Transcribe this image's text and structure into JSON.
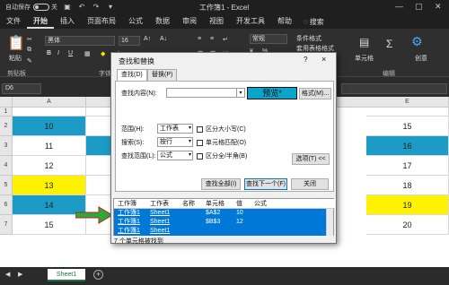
{
  "titlebar": {
    "autosave_label": "自动保存",
    "toggle_state": "关",
    "doc_title": "工作簿1 - Excel"
  },
  "menu": {
    "tabs": [
      "文件",
      "开始",
      "插入",
      "页面布局",
      "公式",
      "数据",
      "审阅",
      "视图",
      "开发工具",
      "帮助"
    ],
    "active_tab": "开始",
    "search_label": "搜索"
  },
  "ribbon": {
    "font_name": "黑体",
    "font_size": "16",
    "number_format": "常规",
    "cond_format": "条件格式",
    "table_format": "套用表格格式",
    "clipboard_label": "剪贴板",
    "font_label": "字体",
    "edit_label": "编辑",
    "create_label": "创意",
    "paste_label": "粘贴",
    "cells_label": "单元格"
  },
  "formula_bar": {
    "name_box": "D6"
  },
  "grid": {
    "columns": [
      "A",
      "",
      "",
      "",
      "",
      "",
      "",
      "E"
    ],
    "rows": [
      "1",
      "2",
      "3",
      "4",
      "5",
      "6",
      "7"
    ],
    "col_a": [
      "",
      "10",
      "11",
      "12",
      "13",
      "14",
      "15"
    ],
    "col_e": [
      "",
      "15",
      "16",
      "17",
      "18",
      "19",
      "20"
    ],
    "colors": {
      "blue": "#1b9bc6",
      "yellow": "#fff200",
      "white": "#ffffff"
    }
  },
  "sheets": {
    "active": "Sheet1"
  },
  "dialog": {
    "title": "查找和替换",
    "help": "?",
    "close": "×",
    "tab_find": "查找(D)",
    "tab_replace": "替换(P)",
    "find_label": "查找内容(N):",
    "preview_label": "预览*",
    "format_button": "格式(M)...",
    "within_label": "范围(H):",
    "within_value": "工作表",
    "search_label": "搜索(S):",
    "search_value": "按行",
    "lookin_label": "查找范围(L):",
    "lookin_value": "公式",
    "match_case": "区分大小写(C)",
    "match_cell": "单元格匹配(O)",
    "match_width": "区分全/半角(B)",
    "options_button": "选项(T) <<",
    "find_all": "查找全部(I)",
    "find_next": "查找下一个(F)",
    "close_button": "关闭",
    "results_headers": [
      "工作簿",
      "工作表",
      "名称",
      "单元格",
      "值",
      "公式"
    ],
    "results": [
      {
        "book": "工作簿1",
        "sheet": "Sheet1",
        "name": "",
        "cell": "$A$2",
        "value": "10",
        "formula": ""
      },
      {
        "book": "工作簿1",
        "sheet": "Sheet1",
        "name": "",
        "cell": "$B$3",
        "value": "12",
        "formula": ""
      },
      {
        "book": "工作簿1",
        "sheet": "Sheet1",
        "name": "",
        "cell": "",
        "value": "",
        "formula": ""
      }
    ],
    "status": "7 个单元格被找到"
  },
  "watermark": "www.bimeiz.com"
}
